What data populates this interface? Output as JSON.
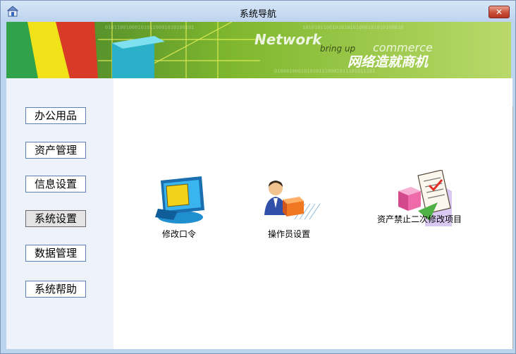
{
  "window": {
    "title": "系统导航"
  },
  "banner": {
    "text_network": "Network",
    "text_bringup": "bring up",
    "text_commerce": "commerce",
    "text_cn": "网络造就商机"
  },
  "nav": [
    {
      "label": "办公用品"
    },
    {
      "label": "资产管理"
    },
    {
      "label": "信息设置"
    },
    {
      "label": "系统设置",
      "active": true
    },
    {
      "label": "数据管理"
    },
    {
      "label": "系统帮助"
    }
  ],
  "functions": [
    {
      "label": "修改口令",
      "icon": "monitor-icon"
    },
    {
      "label": "操作员设置",
      "icon": "operator-icon"
    },
    {
      "label": "资产禁止二次修改项目",
      "icon": "document-box-icon"
    }
  ]
}
